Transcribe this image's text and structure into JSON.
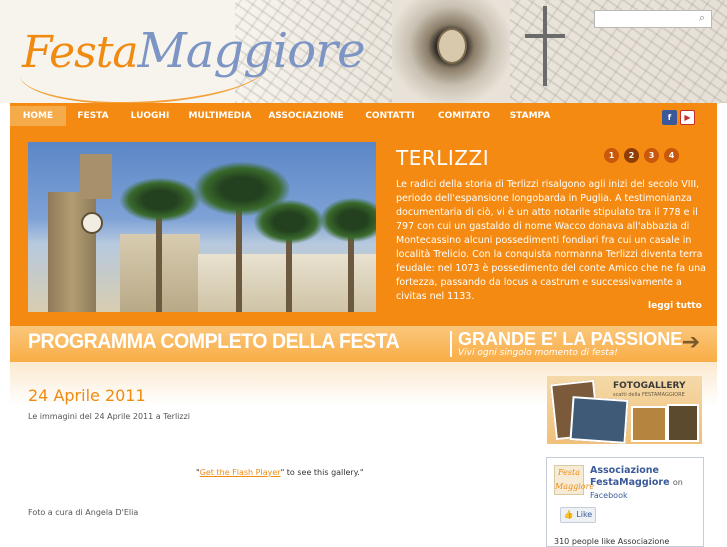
{
  "header": {
    "logo_part1": "Festa",
    "logo_part2": "Maggiore",
    "search_placeholder": ""
  },
  "nav": {
    "items": [
      {
        "label": "HOME",
        "active": true
      },
      {
        "label": "FESTA",
        "active": false
      },
      {
        "label": "LUOGHI",
        "active": false
      },
      {
        "label": "MULTIMEDIA",
        "active": false
      },
      {
        "label": "ASSOCIAZIONE",
        "active": false
      },
      {
        "label": "CONTATTI",
        "active": false
      },
      {
        "label": "COMITATO",
        "active": false
      },
      {
        "label": "STAMPA",
        "active": false
      }
    ],
    "social": {
      "facebook": "f",
      "youtube": "You\nTube"
    }
  },
  "hero": {
    "title": "TERLIZZI",
    "pages": [
      "1",
      "2",
      "3",
      "4"
    ],
    "active_page": "2",
    "text": "Le radici della storia di Terlizzi risalgono agli inizi del secolo VIII, periodo dell'espansione longobarda in Puglia. A testimonianza documentaria di ciò, vi è un atto notarile stipulato tra il 778 e il 797 con cui un gastaldo di nome Wacco donava all'abbazia di Montecassino alcuni possedimenti fondiari fra cui un casale in località Trelicio. Con la conquista normanna Terlizzi diventa terra feudale: nel 1073 è possedimento del conte Amico che ne fa una fortezza, passando da locus a castrum e successivamente a civitas nel 1133.",
    "read_more": "leggi tutto"
  },
  "banner": {
    "left": "PROGRAMMA COMPLETO DELLA FESTA",
    "right": "GRANDE E' LA PASSIONE",
    "sub": "Vivi ogni singolo momento di festa!"
  },
  "main": {
    "date_title": "24 Aprile 2011",
    "subtitle": "Le immagini del 24 Aprile 2011 a Terlizzi",
    "flash_link": "Get the Flash Player",
    "flash_text": " to see this gallery.",
    "credit": "Foto a cura di Angela D'Elia"
  },
  "sidebar": {
    "fotogallery_title": "FOTOGALLERY",
    "fotogallery_sub": "scatti della FESTAMAGGIORE",
    "fb_logo": "Festa Maggiore",
    "fb_name": "Associazione FestaMaggiore",
    "fb_on": "on",
    "fb_sub": "Facebook",
    "fb_like": "Like",
    "fb_count": "310 people like Associazione"
  },
  "colors": {
    "accent": "#f58a12",
    "brand_blue": "#7d95c4",
    "facebook": "#3b5998"
  }
}
